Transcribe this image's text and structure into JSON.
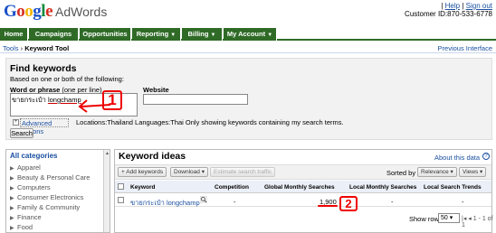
{
  "header": {
    "logo_google": "Google",
    "logo_product": "AdWords",
    "help": "Help",
    "sign_out": "Sign out",
    "customer_id": "Customer ID:870-533-6778"
  },
  "nav": {
    "tabs": [
      {
        "label": "Home",
        "caret": ""
      },
      {
        "label": "Campaigns",
        "caret": ""
      },
      {
        "label": "Opportunities",
        "caret": ""
      },
      {
        "label": "Reporting",
        "caret": "▼"
      },
      {
        "label": "Billing",
        "caret": "▼"
      },
      {
        "label": "My Account",
        "caret": "▼"
      }
    ]
  },
  "breadcrumb": {
    "tools": "Tools",
    "sep": " › ",
    "current": "Keyword Tool",
    "previous_interface": "Previous Interface"
  },
  "find": {
    "title": "Find keywords",
    "subtitle": "Based on one or both of the following:",
    "word_label": "Word or phrase",
    "word_hint": " (one per line)",
    "word_value_thai": "ขายกระเป๋า ",
    "word_value_brand": "longchamp",
    "website_label": "Website",
    "website_value": "",
    "adv_toggle": "+",
    "advanced_options": "Advanced options",
    "locations_info": "Locations:Thailand  Languages:Thai  Only showing keywords containing my search terms.",
    "search_button": "Search",
    "annotation_1": "1"
  },
  "categories": {
    "title": "All categories",
    "items": [
      "Apparel",
      "Beauty & Personal Care",
      "Computers",
      "Consumer Electronics",
      "Family & Community",
      "Finance",
      "Food"
    ]
  },
  "keyword_ideas": {
    "title": "Keyword ideas",
    "about": "About this data",
    "about_icon": "?",
    "toolbar": {
      "add_keywords": "+ Add keywords",
      "download": "Download ▾",
      "estimate": "Estimate search traffic",
      "sorted_by": "Sorted by",
      "relevance": "Relevance ▾",
      "views": "Views ▾"
    },
    "columns": [
      "Keyword",
      "Competition",
      "Global Monthly Searches",
      "Local Monthly Searches",
      "Local Search Trends"
    ],
    "rows": [
      {
        "keyword": "ขายกระเป๋า longchamp",
        "competition": "-",
        "global": "1,900",
        "local": "-",
        "trends": "-"
      }
    ],
    "annotation_2": "2",
    "show_rows_label": "Show rows",
    "show_rows_value": "50 ▾",
    "pager": "|◂ ◂ 1 - 1 of 1"
  },
  "colors": {
    "nav_green": "#2f6b27",
    "link_blue": "#1a4fa0",
    "annotation_red": "#e00000"
  }
}
